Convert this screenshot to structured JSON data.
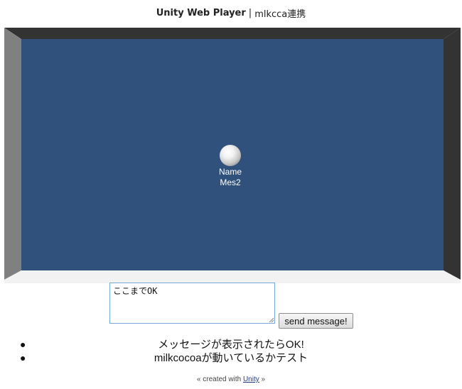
{
  "page": {
    "title_bold": "Unity Web Player",
    "title_sep": "|",
    "title_rest": "mlkcca連携"
  },
  "game": {
    "player_name": "Name",
    "player_message": "Mes2",
    "colors": {
      "floor": "#30517c",
      "wall_left": "#808080",
      "wall_right": "#333333",
      "wall_top": "#333333",
      "wall_bottom": "#f2f2f2"
    }
  },
  "form": {
    "message_value": "ここまでOK",
    "send_label": "send message!"
  },
  "messages": [
    "メッセージが表示されたらOK!",
    "milkcocoaが動いているかテスト"
  ],
  "footer": {
    "prefix": "« created with ",
    "link_text": "Unity",
    "suffix": " »"
  }
}
